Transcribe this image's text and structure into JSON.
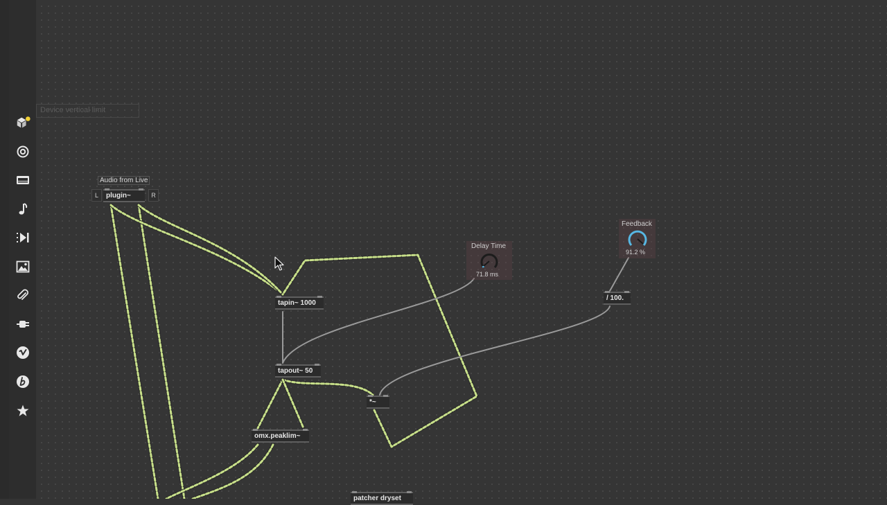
{
  "sidebar": {
    "items": [
      {
        "icon": "package-icon"
      },
      {
        "icon": "target-icon"
      },
      {
        "icon": "film-strip-icon"
      },
      {
        "icon": "music-note-icon"
      },
      {
        "icon": "step-forward-icon"
      },
      {
        "icon": "image-icon"
      },
      {
        "icon": "paperclip-icon"
      },
      {
        "icon": "plug-icon"
      },
      {
        "icon": "vimeo-icon"
      },
      {
        "icon": "bpatcher-icon"
      },
      {
        "icon": "star-icon"
      }
    ],
    "notification_color": "#f1d034"
  },
  "canvas": {
    "device_limit_label": "Device vertical limit",
    "comments": {
      "audio_from_live": "Audio from Live"
    },
    "plugin_buttons": {
      "left": "L",
      "right": "R"
    },
    "objects": {
      "plugin": "plugin~",
      "tapin": "tapin~ 1000",
      "tapout": "tapout~ 50",
      "multiply": "*~",
      "divide": "/ 100.",
      "peaklim": "omx.peaklim~",
      "patcher": "patcher dryset"
    },
    "dials": {
      "delay_time": {
        "label": "Delay Time",
        "value": "71.8 ms"
      },
      "feedback": {
        "label": "Feedback",
        "value": "91.2 %"
      }
    }
  },
  "colors": {
    "signal_cord": "#c8e08a",
    "control_cord": "#9a9a9a",
    "dial_arc": "#57b7e3",
    "background": "#353535"
  }
}
